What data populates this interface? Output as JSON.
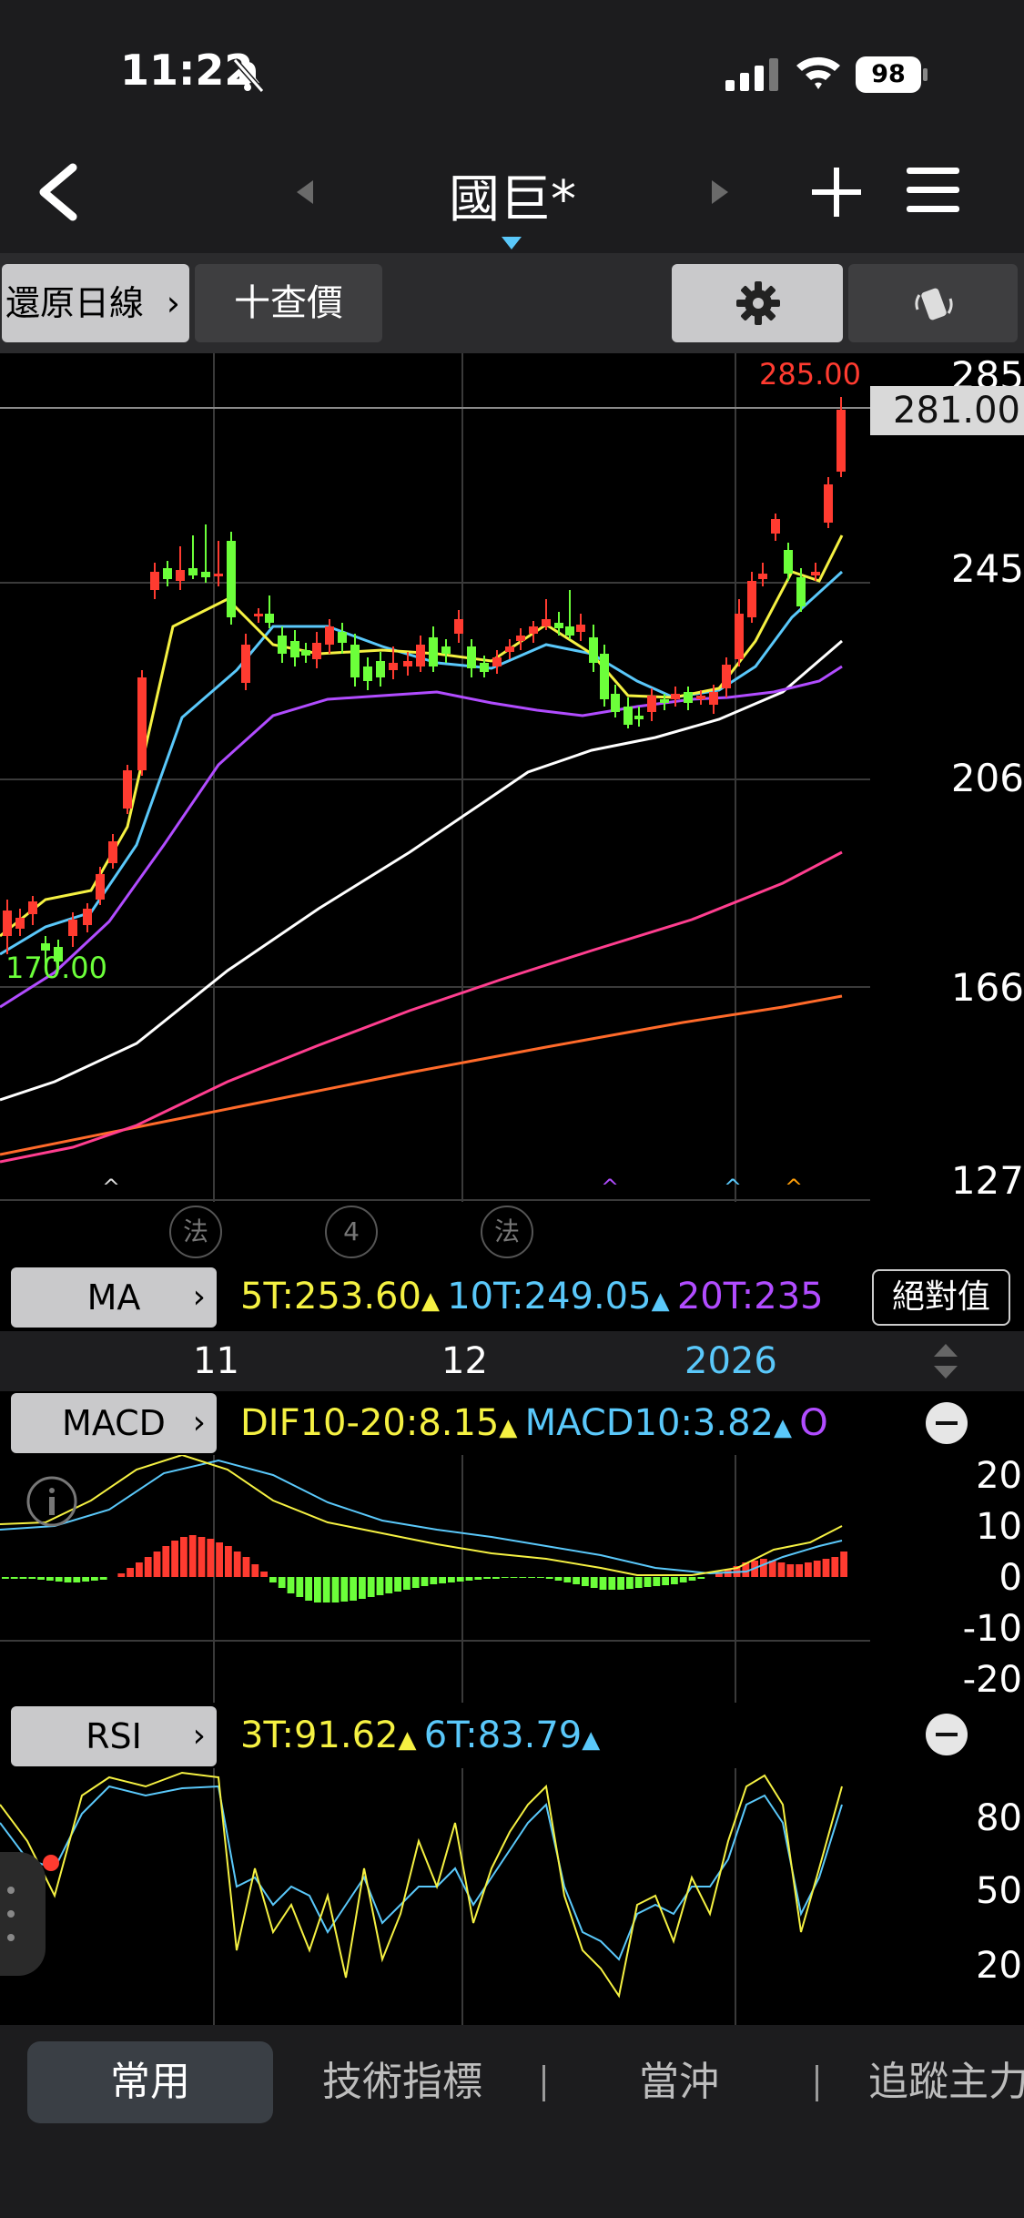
{
  "status_bar": {
    "time": "11:22",
    "battery": "98"
  },
  "header": {
    "title": "國巨*"
  },
  "toolbar": {
    "restore_label": "還原日線",
    "query_label": "十查價"
  },
  "price_chart": {
    "axis_labels": [
      "285",
      "245",
      "206",
      "166",
      "127"
    ],
    "current_price": "281.00",
    "high_label": "285.00",
    "low_label": "170.00",
    "event_badges": [
      "法",
      "4",
      "法"
    ]
  },
  "ma_legend": {
    "tag": "MA",
    "items": [
      {
        "text": "5T:253.60",
        "color": "#f5f142"
      },
      {
        "text": "10T:249.05",
        "color": "#5ac8fa"
      },
      {
        "text": "20T:235",
        "color": "#b14cff"
      }
    ],
    "abs_label": "絕對值"
  },
  "date_axis": {
    "labels": [
      "11",
      "12",
      "2026"
    ],
    "year_color": "#5ac8fa"
  },
  "macd": {
    "tag": "MACD",
    "items": [
      {
        "text": "DIF10-20:8.15",
        "color": "#f5f142"
      },
      {
        "text": "MACD10:3.82",
        "color": "#5ac8fa"
      },
      {
        "text": "O",
        "color": "#b14cff"
      }
    ],
    "axis_labels": [
      "20",
      "10",
      "0",
      "-10",
      "-20"
    ]
  },
  "rsi": {
    "tag": "RSI",
    "items": [
      {
        "text": "3T:91.62",
        "color": "#f5f142"
      },
      {
        "text": "6T:83.79",
        "color": "#5ac8fa"
      }
    ],
    "axis_labels": [
      "80",
      "50",
      "20"
    ]
  },
  "tabs": [
    "常用",
    "技術指標",
    "當沖",
    "追蹤主力"
  ],
  "colors": {
    "up": "#ff3b30",
    "down": "#6cff3a",
    "ma5": "#f5f142",
    "ma10": "#5ac8fa",
    "ma20": "#b14cff",
    "ma60": "#ffffff",
    "ma120": "#ff3e8f",
    "ma240": "#ff6a2a"
  }
}
